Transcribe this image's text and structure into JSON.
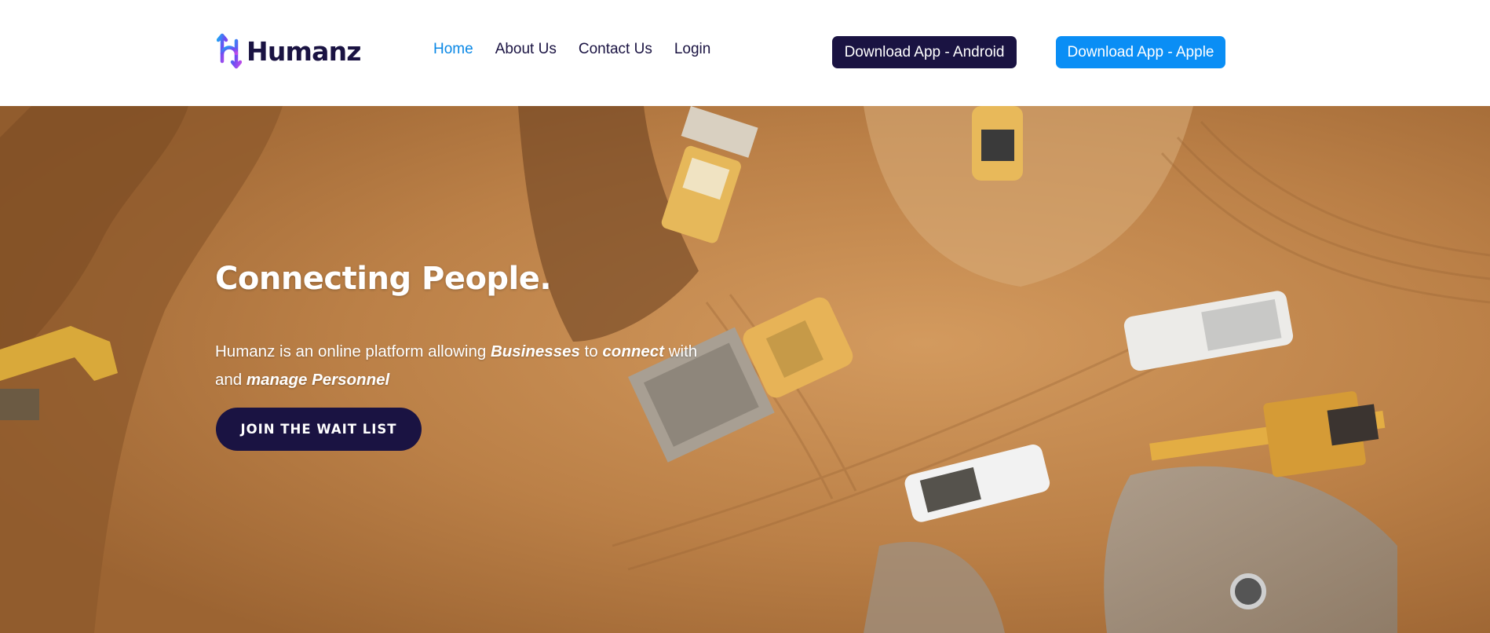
{
  "header": {
    "logo_text": "Humanz",
    "nav": {
      "home": "Home",
      "about": "About Us",
      "contact": "Contact Us",
      "login": "Login"
    },
    "download_android": "Download App - Android",
    "download_apple": "Download App - Apple"
  },
  "hero": {
    "title": "Connecting People.",
    "text_1": "Humanz is an online platform allowing ",
    "text_businesses": "Businesses",
    "text_2": " to ",
    "text_connect": "connect",
    "text_3": " with and ",
    "text_manage": "manage Personnel",
    "cta": "JOIN THE WAIT LIST",
    "background_image": "aerial-construction-site-photo"
  },
  "colors": {
    "navy": "#1a1342",
    "blue": "#0a8ef5",
    "nav_active": "#0a88e6",
    "dirt": "#b0773f"
  }
}
